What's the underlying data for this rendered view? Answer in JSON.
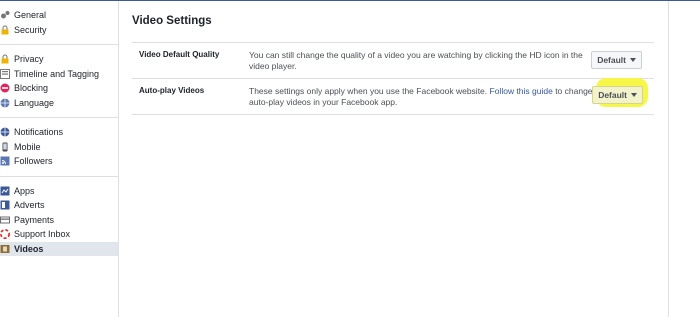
{
  "sidebar": {
    "groups": [
      [
        {
          "label": "General",
          "icon": "gears-icon",
          "color": "#777"
        },
        {
          "label": "Security",
          "icon": "lock-icon",
          "color": "#f0b400"
        }
      ],
      [
        {
          "label": "Privacy",
          "icon": "padlock-icon",
          "color": "#f0b400"
        },
        {
          "label": "Timeline and Tagging",
          "icon": "timeline-icon",
          "color": "#7a7a7a"
        },
        {
          "label": "Blocking",
          "icon": "block-icon",
          "color": "#e0245e"
        },
        {
          "label": "Language",
          "icon": "globe-icon",
          "color": "#5b77b3"
        }
      ],
      [
        {
          "label": "Notifications",
          "icon": "globe-icon",
          "color": "#3b5998"
        },
        {
          "label": "Mobile",
          "icon": "mobile-icon",
          "color": "#4a4a4a"
        },
        {
          "label": "Followers",
          "icon": "rss-icon",
          "color": "#5b77b3"
        }
      ],
      [
        {
          "label": "Apps",
          "icon": "apps-icon",
          "color": "#3b5998"
        },
        {
          "label": "Adverts",
          "icon": "adverts-icon",
          "color": "#3b5998"
        },
        {
          "label": "Payments",
          "icon": "card-icon",
          "color": "#6c6c6c"
        },
        {
          "label": "Support Inbox",
          "icon": "lifebuoy-icon",
          "color": "#e02020"
        },
        {
          "label": "Videos",
          "icon": "film-icon",
          "color": "#8a6d3b",
          "active": true
        }
      ]
    ]
  },
  "main": {
    "title": "Video Settings",
    "rows": [
      {
        "name": "Video Default Quality",
        "desc": "You can still change the quality of a video you are watching by clicking the HD icon in the video player.",
        "button": "Default"
      },
      {
        "name": "Auto-play Videos",
        "desc_before": "These settings only apply when you use the Facebook website. ",
        "desc_link": "Follow this guide",
        "desc_after": " to change auto-play videos in your Facebook app.",
        "button": "Default",
        "highlighted": true
      }
    ]
  }
}
